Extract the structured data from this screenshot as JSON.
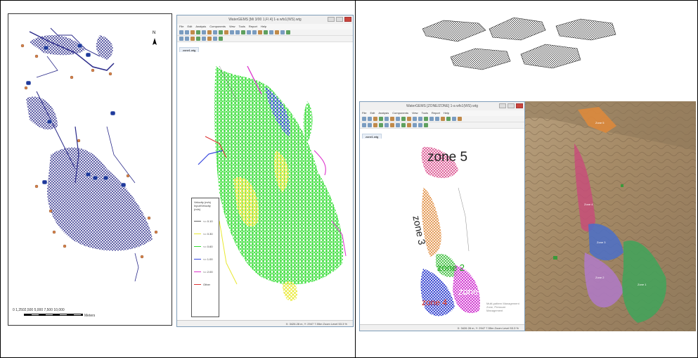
{
  "left_map": {
    "north_label": "N",
    "scalebar_label": "0  1,2502,500    5,000      7,500      10,000",
    "scalebar_unit": "Meters"
  },
  "window1": {
    "title": "WaterGEMS  [Mi 3/00 1,F/.4] 1-a wfs1(WS).wtg",
    "menus": [
      "File",
      "Edit",
      "Analysis",
      "Components",
      "View",
      "Tools",
      "Report",
      "Help"
    ],
    "doc_tab": "zone1.wtg",
    "legend_title": "Velocity (m/s) Input/Velocity (m/s)",
    "legend_items": [
      {
        "label": "<= 0.10",
        "color": "#666666"
      },
      {
        "label": "<= 0.30",
        "color": "#e8e830"
      },
      {
        "label": "<= 0.60",
        "color": "#33dd33"
      },
      {
        "label": "<= 1.00",
        "color": "#3344dd"
      },
      {
        "label": "<= 2.00",
        "color": "#dd33cc"
      },
      {
        "label": "Other",
        "color": "#dd3333"
      }
    ],
    "status": "X: 3426.28 m, Y: 2947 7.55m    Zoom Level 53.3 %"
  },
  "window2": {
    "title": "WaterGEMS  [ZONE/ZONE] 1-a wfs1(WS).wtg",
    "menus": [
      "File",
      "Edit",
      "Analysis",
      "Components",
      "View",
      "Tools",
      "Report",
      "Help"
    ],
    "doc_tab": "zone1.wtg",
    "zones": [
      {
        "label": "zone 5",
        "color": "#222222"
      },
      {
        "label": "zone 3",
        "color": "#222222"
      },
      {
        "label": "zone 2",
        "color": "#22aa22"
      },
      {
        "label": "zone 1",
        "color": "#ffffff"
      },
      {
        "label": "zone 4",
        "color": "#dd3322"
      }
    ],
    "credit": "Multi-pattern Management Zone, Pressure Management",
    "status": "X: 3426 28 m, Y: 2947 7.55m    Zoom Level 53.3 %"
  },
  "satellite": {
    "zone_labels": [
      "Zone 5",
      "Zone 4",
      "Zone 3",
      "Zone 2",
      "Zone 1"
    ]
  },
  "colors": {
    "network_blue": "#2b2b8a",
    "tank_blue": "#1f3a9c",
    "pipe_green": "#33dd33",
    "pipe_yellow": "#e8e830",
    "pipe_blue": "#3344dd",
    "pipe_magenta": "#dd33cc",
    "zone_orange": "#e08a3a",
    "zone_pink": "#c94a7a",
    "zone_blue": "#4a6fc9",
    "zone_violet": "#b07ac9",
    "zone_green": "#3fa45a"
  }
}
